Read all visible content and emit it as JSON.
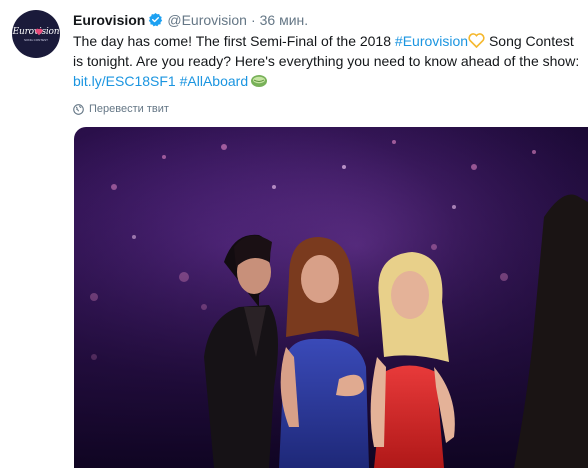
{
  "tweet": {
    "author_name": "Eurovision",
    "handle": "@Eurovision",
    "separator": "·",
    "time": "36 мин.",
    "text": {
      "line1_a": "The day has come! The first Semi-Final of the 2018 ",
      "hashtag_eurovision": "#Eurovision",
      "line1_b": " Song Contest",
      "line2": "is tonight. Are you ready? Here's everything you need to know ahead of the show:",
      "link": "bit.ly/ESC18SF1",
      "hashtag_allaboard": "#AllAboard"
    },
    "translate_label": "Перевести твит",
    "avatar": {
      "logo_text": "Eurovision",
      "logo_subtext": "SONG CONTEST"
    }
  },
  "colors": {
    "link": "#1b95e0",
    "verified": "#1da1f2",
    "muted": "#657786",
    "avatar_bg": "#1a1a3a"
  },
  "icons": [
    "verified-badge-icon",
    "heart-emoji-icon",
    "melon-emoji-icon",
    "globe-icon"
  ]
}
